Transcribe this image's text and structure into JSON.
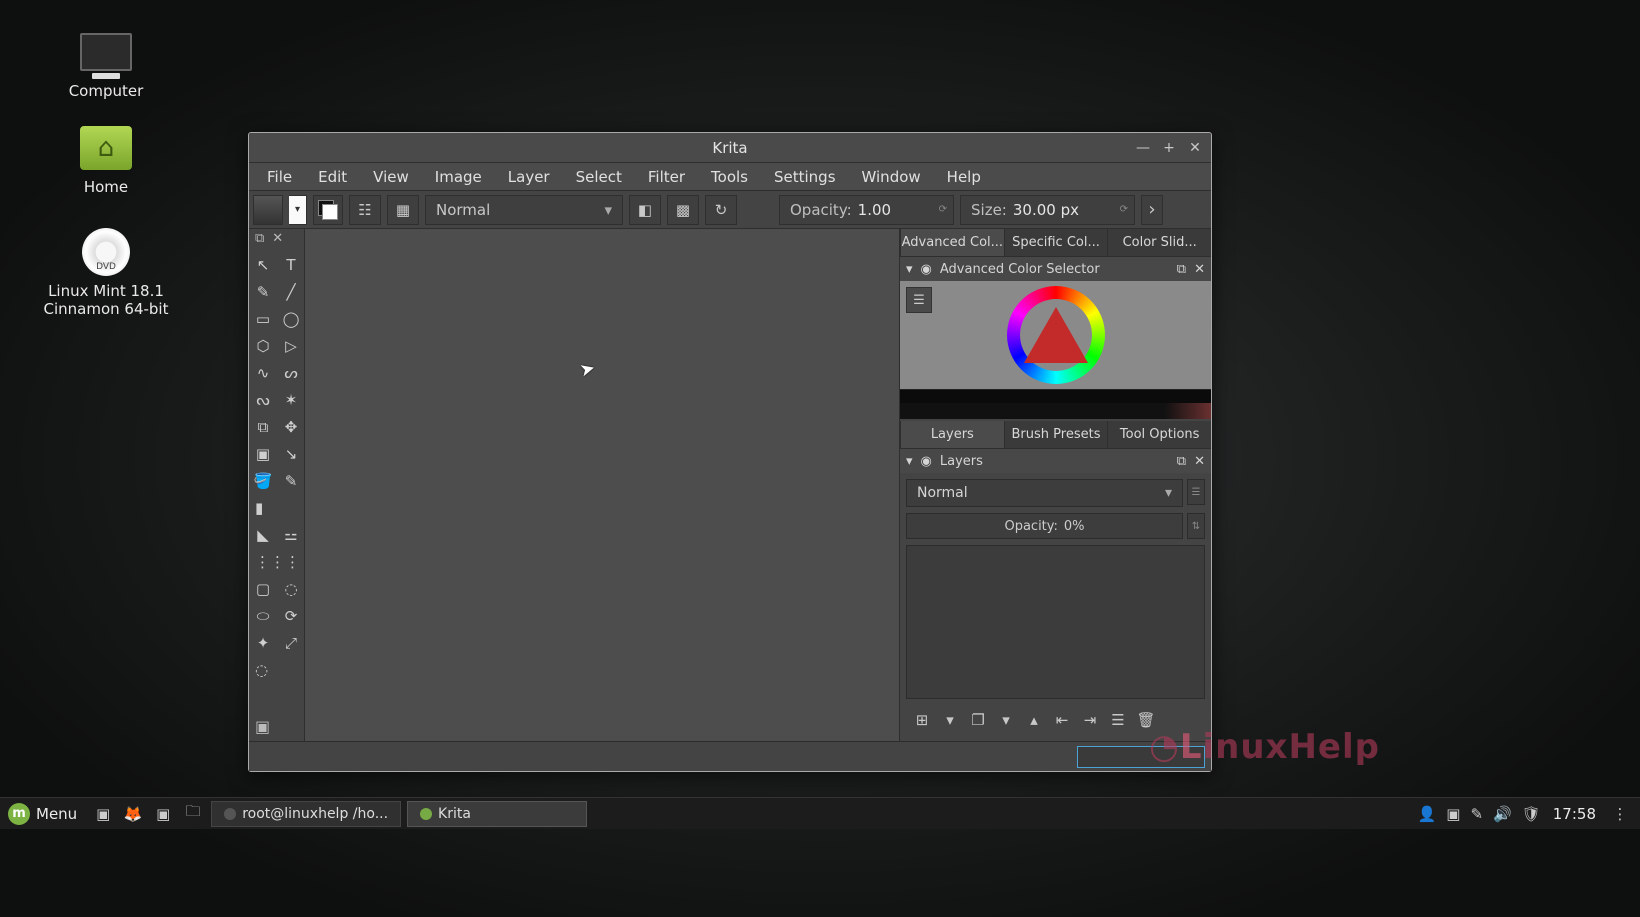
{
  "desktop": {
    "icons": {
      "computer": "Computer",
      "home": "Home",
      "dvd_line1": "Linux Mint 18.1",
      "dvd_line2": "Cinnamon 64-bit"
    }
  },
  "window": {
    "title": "Krita",
    "menu": {
      "file": "File",
      "edit": "Edit",
      "view": "View",
      "image": "Image",
      "layer": "Layer",
      "select": "Select",
      "filter": "Filter",
      "tools": "Tools",
      "settings": "Settings",
      "window_": "Window",
      "help": "Help"
    },
    "toolbar": {
      "blend_mode": "Normal",
      "opacity_label": "Opacity:",
      "opacity_value": "1.00",
      "size_label": "Size:",
      "size_value": "30.00 px"
    },
    "dockers": {
      "top_tabs": {
        "advcol": "Advanced Col...",
        "speccol": "Specific Col...",
        "colslid": "Color Slid..."
      },
      "color_panel_title": "Advanced Color Selector",
      "bottom_tabs": {
        "layers": "Layers",
        "brush": "Brush Presets",
        "toolopt": "Tool Options"
      },
      "layers_panel_title": "Layers",
      "layers_blend": "Normal",
      "layers_opacity_label": "Opacity:",
      "layers_opacity_value": "0%"
    }
  },
  "taskbar": {
    "menu": "Menu",
    "task1": "root@linuxhelp /ho...",
    "task2": "Krita",
    "clock": "17:58"
  },
  "watermark": {
    "a": "L",
    "b": "inuxHelp"
  }
}
